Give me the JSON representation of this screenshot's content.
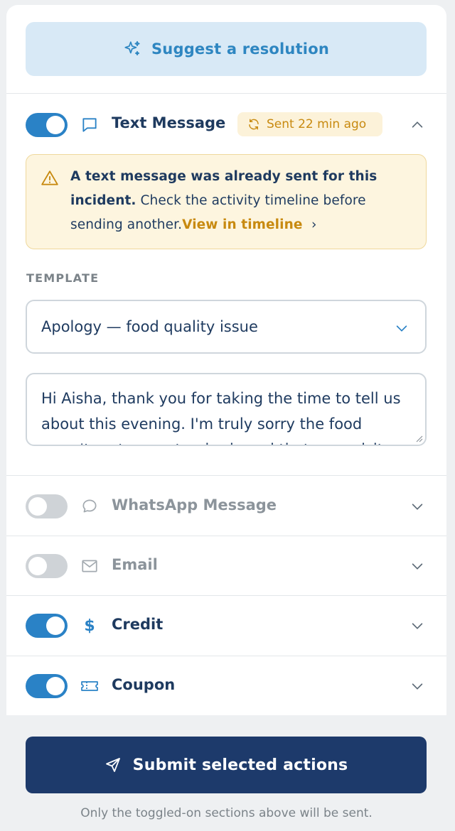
{
  "suggest": {
    "label": "Suggest a resolution",
    "icon": "sparkle-icon"
  },
  "text_message": {
    "title": "Text Message",
    "enabled": true,
    "badge": "Sent 22 min ago",
    "alert": {
      "bold": "A text message was already sent for this incident.",
      "text": " Check the activity timeline before sending another.",
      "link": "View in timeline"
    },
    "template_label": "TEMPLATE",
    "template_value": "Apology — food quality issue",
    "message": "Hi Aisha, thank you for taking the time to tell us about this evening. I'm truly sorry the food wasn't up to our standards and that your visit was disappointing."
  },
  "sections": [
    {
      "title": "WhatsApp Message",
      "enabled": false,
      "icon": "chat-bubble-icon"
    },
    {
      "title": "Email",
      "enabled": false,
      "icon": "mail-icon"
    },
    {
      "title": "Credit",
      "enabled": true,
      "icon": "dollar-icon"
    },
    {
      "title": "Coupon",
      "enabled": true,
      "icon": "ticket-icon"
    }
  ],
  "submit": {
    "label": "Submit selected actions",
    "note": "Only the toggled-on sections above will be sent."
  },
  "colors": {
    "accent": "#2a82c6",
    "primary": "#1d3a6b",
    "warning": "#c88a10"
  }
}
